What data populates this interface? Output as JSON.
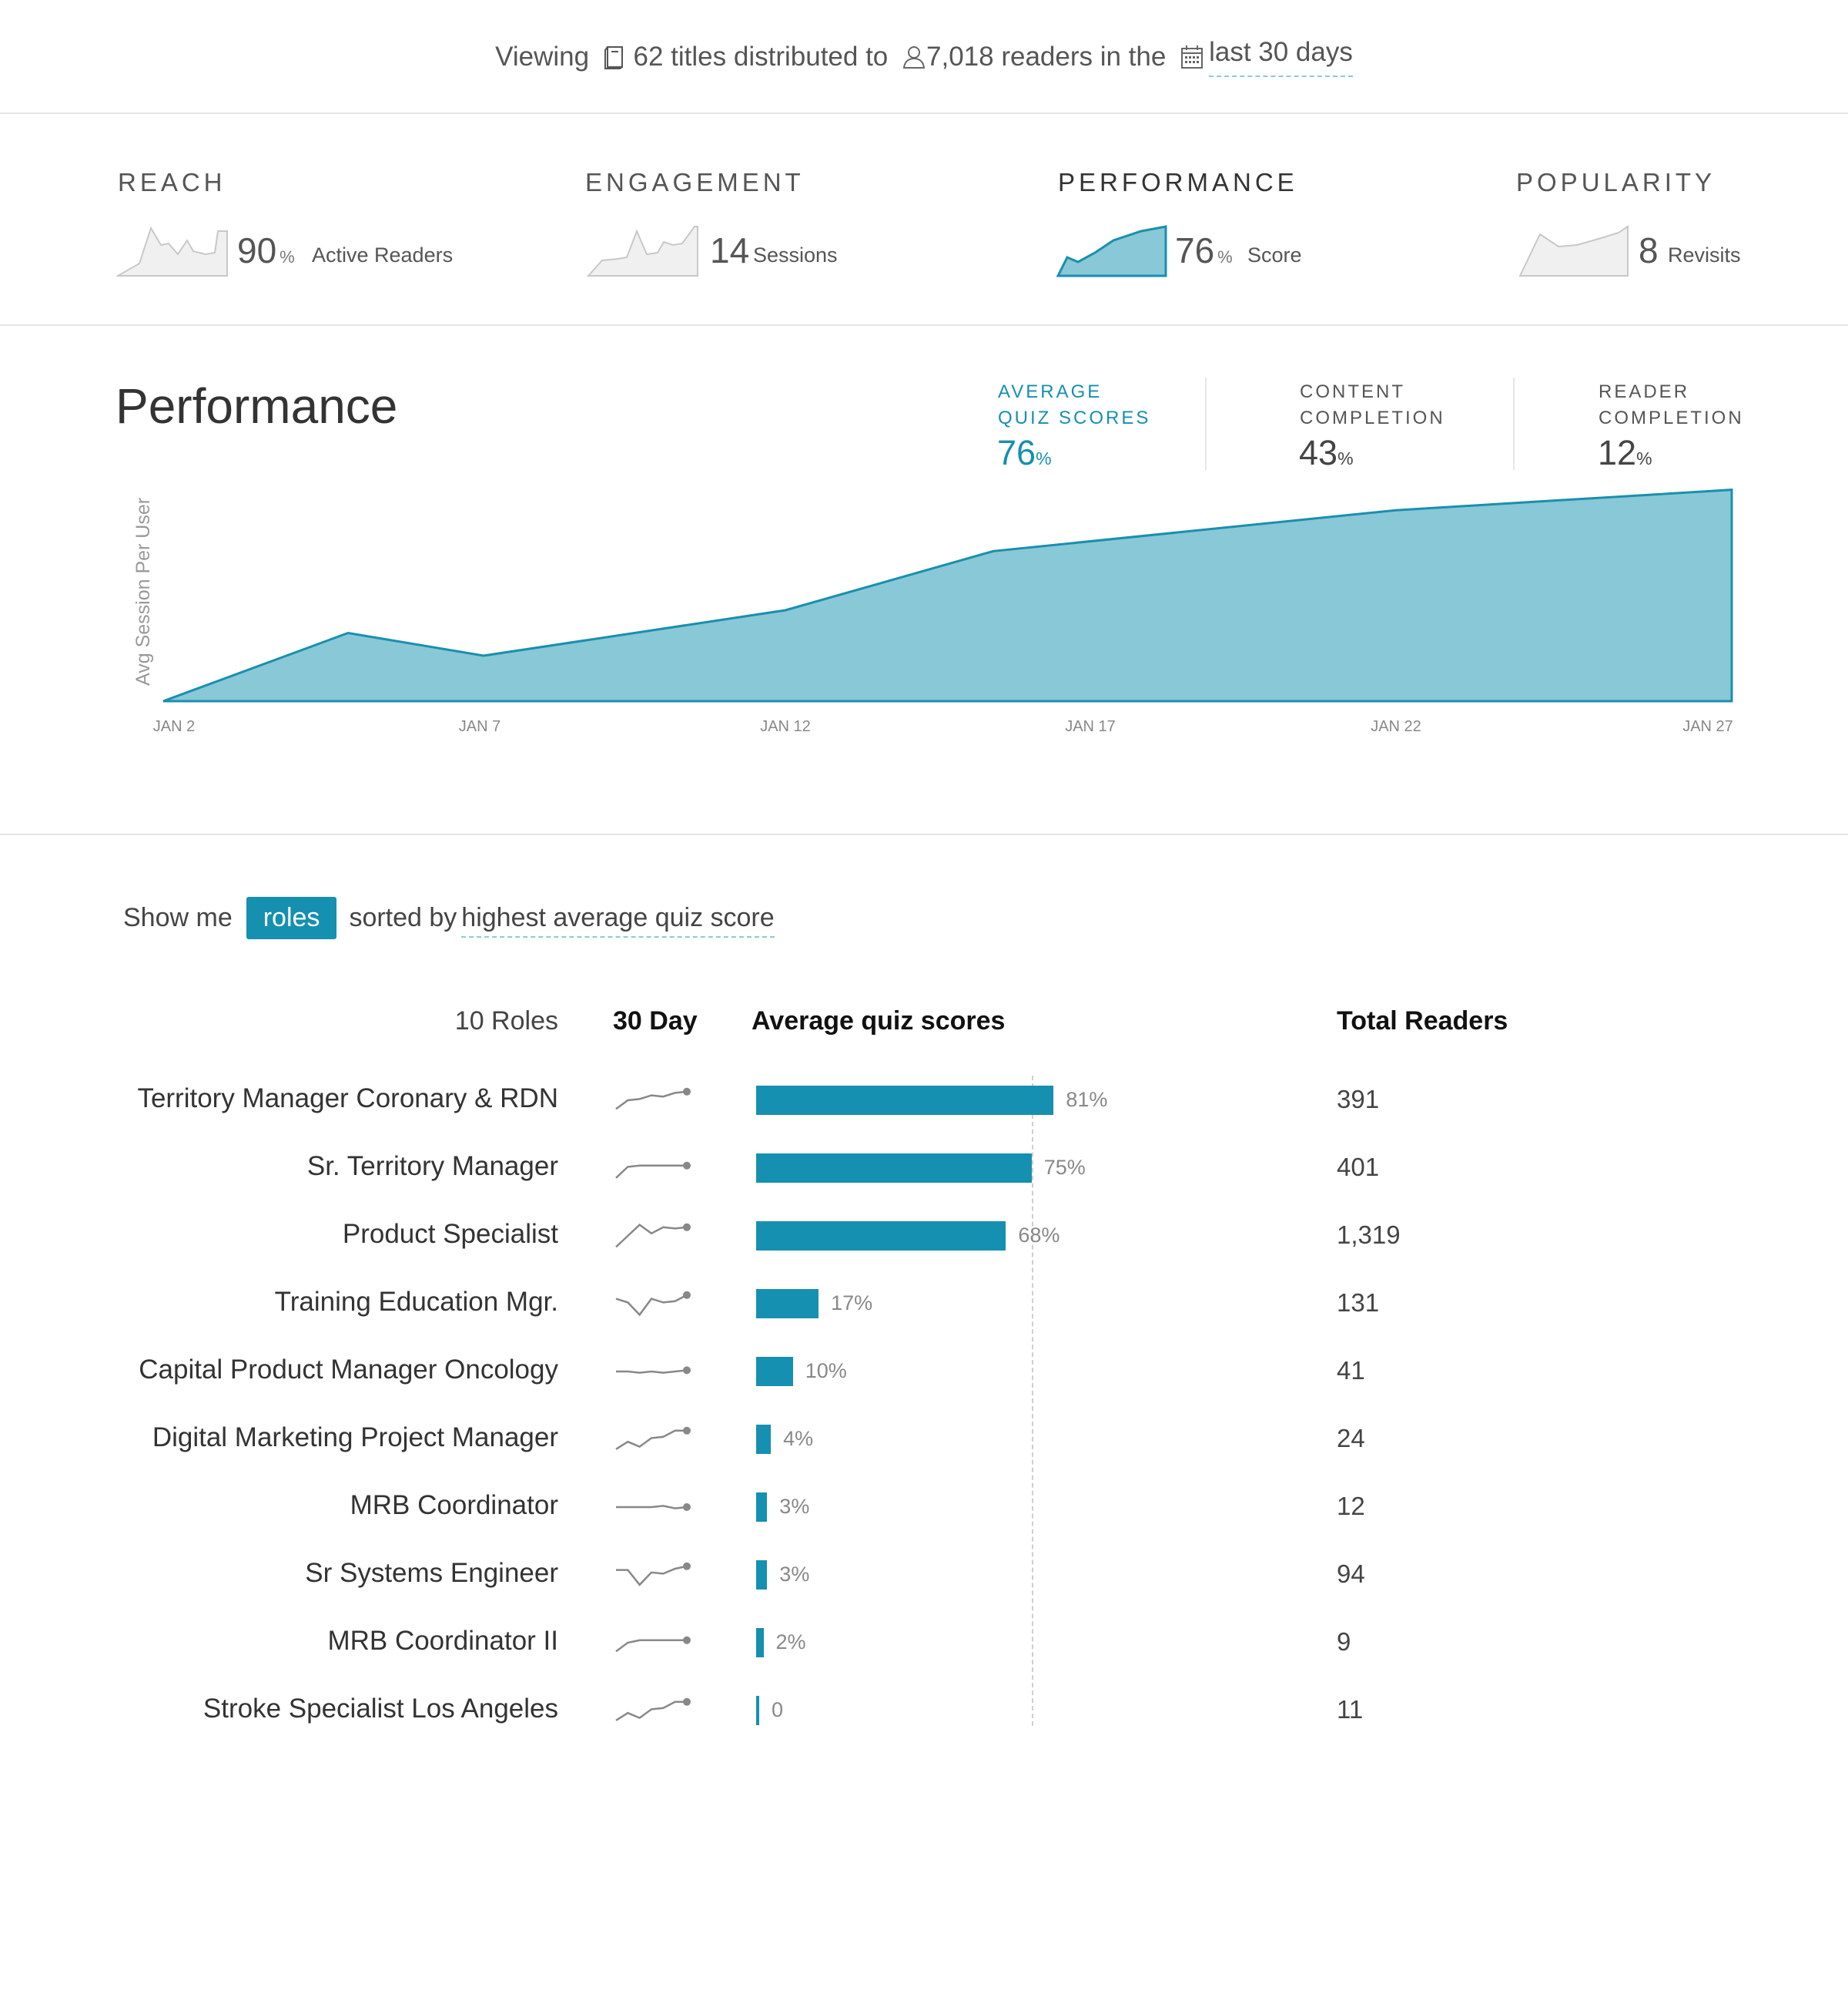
{
  "summary": {
    "prefix": "Viewing",
    "titles": "62 titles distributed to",
    "readers": "7,018 readers in the",
    "period": "last 30 days"
  },
  "metrics": [
    {
      "label": "REACH",
      "value": "90",
      "unit": "%",
      "desc": "Active Readers"
    },
    {
      "label": "ENGAGEMENT",
      "value": "14",
      "unit": "",
      "desc": "Sessions"
    },
    {
      "label": "PERFORMANCE",
      "value": "76",
      "unit": "%",
      "desc": "Score"
    },
    {
      "label": "POPULARITY",
      "value": "8",
      "unit": "",
      "desc": "Revisits"
    }
  ],
  "performance": {
    "title": "Performance",
    "stats": [
      {
        "line1": "AVERAGE",
        "line2": "QUIZ SCORES",
        "value": "76",
        "unit": "%"
      },
      {
        "line1": "CONTENT",
        "line2": "COMPLETION",
        "value": "43",
        "unit": "%"
      },
      {
        "line1": "READER",
        "line2": "COMPLETION",
        "value": "12",
        "unit": "%"
      }
    ],
    "ylabel": "Avg Session Per User",
    "xticks": [
      "JAN 2",
      "JAN 7",
      "JAN 12",
      "JAN 17",
      "JAN 22",
      "JAN 27"
    ]
  },
  "chart_data": {
    "type": "area",
    "x": [
      "JAN 2",
      "JAN 5",
      "JAN 7",
      "JAN 12",
      "JAN 16",
      "JAN 22",
      "JAN 27"
    ],
    "values": [
      0,
      0.3,
      0.2,
      0.4,
      0.66,
      0.84,
      0.93
    ],
    "ylabel": "Avg Session Per User",
    "ylim": [
      0,
      1
    ],
    "color": "#88c8d7",
    "line_color": "#1a8fad"
  },
  "roles": {
    "show_me": "Show me",
    "pill": "roles",
    "sorted_by": "sorted by",
    "sort_field": "highest average quiz score",
    "head_count": "10 Roles",
    "head_trend": "30 Day",
    "head_score": "Average quiz scores",
    "head_readers": "Total Readers",
    "bar_color": "#1590b0",
    "reference_value": 75,
    "rows": [
      {
        "name": "Territory Manager Coronary & RDN",
        "score": 81,
        "label": "81%",
        "readers": "391",
        "trend": [
          0.15,
          0.5,
          0.55,
          0.7,
          0.65,
          0.8,
          0.85
        ]
      },
      {
        "name": "Sr. Territory Manager",
        "score": 75,
        "label": "75%",
        "readers": "401",
        "trend": [
          0.1,
          0.55,
          0.6,
          0.6,
          0.6,
          0.6,
          0.6
        ]
      },
      {
        "name": "Product Specialist",
        "score": 68,
        "label": "68%",
        "readers": "1,319",
        "trend": [
          0.05,
          0.5,
          0.95,
          0.6,
          0.85,
          0.8,
          0.85
        ]
      },
      {
        "name": "Training Education Mgr.",
        "score": 17,
        "label": "17%",
        "readers": "131",
        "trend": [
          0.7,
          0.55,
          0.05,
          0.7,
          0.55,
          0.6,
          0.85
        ]
      },
      {
        "name": "Capital Product Manager Oncology",
        "score": 10,
        "label": "10%",
        "readers": "41",
        "trend": [
          0.5,
          0.5,
          0.45,
          0.5,
          0.45,
          0.5,
          0.55
        ]
      },
      {
        "name": "Digital Marketing Project Manager",
        "score": 4,
        "label": "4%",
        "readers": "24",
        "trend": [
          0.1,
          0.4,
          0.2,
          0.55,
          0.6,
          0.85,
          0.85
        ]
      },
      {
        "name": "MRB Coordinator",
        "score": 3,
        "label": "3%",
        "readers": "12",
        "trend": [
          0.5,
          0.5,
          0.5,
          0.5,
          0.55,
          0.45,
          0.5
        ]
      },
      {
        "name": "Sr Systems Engineer",
        "score": 3,
        "label": "3%",
        "readers": "94",
        "trend": [
          0.7,
          0.7,
          0.1,
          0.6,
          0.55,
          0.75,
          0.85
        ]
      },
      {
        "name": "MRB Coordinator II",
        "score": 2,
        "label": "2%",
        "readers": "9",
        "trend": [
          0.15,
          0.5,
          0.6,
          0.6,
          0.6,
          0.6,
          0.6
        ]
      },
      {
        "name": "Stroke Specialist Los Angeles",
        "score": 0,
        "label": "0",
        "readers": "11",
        "trend": [
          0.1,
          0.4,
          0.2,
          0.55,
          0.6,
          0.85,
          0.85
        ]
      }
    ]
  }
}
